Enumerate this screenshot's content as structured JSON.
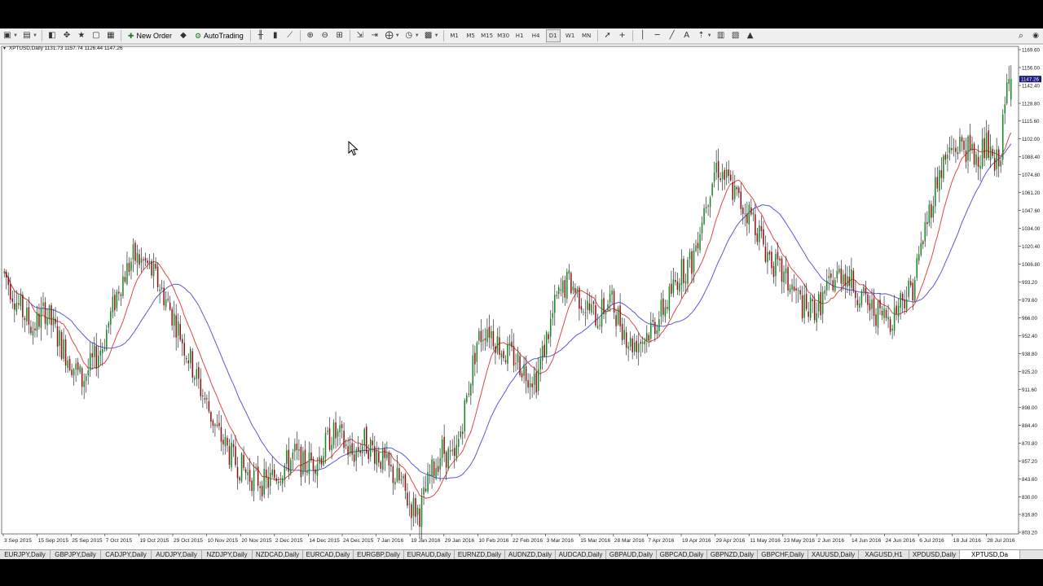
{
  "toolbar": {
    "items": [
      {
        "type": "icon",
        "name": "new-chart-icon",
        "symbol": "▣",
        "dropdown": true
      },
      {
        "type": "icon",
        "name": "profiles-icon",
        "symbol": "▤",
        "dropdown": true
      },
      {
        "type": "sep"
      },
      {
        "type": "icon",
        "name": "market-watch-icon",
        "symbol": "◧"
      },
      {
        "type": "icon",
        "name": "data-window-icon",
        "symbol": "✥"
      },
      {
        "type": "icon",
        "name": "navigator-icon",
        "symbol": "★"
      },
      {
        "type": "icon",
        "name": "terminal-icon",
        "symbol": "▢"
      },
      {
        "type": "icon",
        "name": "strategy-tester-icon",
        "symbol": "▦"
      },
      {
        "type": "sep"
      },
      {
        "type": "text",
        "name": "new-order-button",
        "icon": "✚",
        "label": "New Order"
      },
      {
        "type": "icon",
        "name": "metaeditor-icon",
        "symbol": "◆"
      },
      {
        "type": "text",
        "name": "autotrading-button",
        "icon": "⚙",
        "label": "AutoTrading"
      },
      {
        "type": "sep"
      },
      {
        "type": "icon",
        "name": "bar-chart-icon",
        "symbol": "╫"
      },
      {
        "type": "icon",
        "name": "candlesticks-icon",
        "symbol": "▮"
      },
      {
        "type": "icon",
        "name": "line-chart-icon",
        "symbol": "⟋"
      },
      {
        "type": "sep"
      },
      {
        "type": "icon",
        "name": "zoom-in-icon",
        "symbol": "⊕"
      },
      {
        "type": "icon",
        "name": "zoom-out-icon",
        "symbol": "⊖"
      },
      {
        "type": "icon",
        "name": "tile-windows-icon",
        "symbol": "⊞"
      },
      {
        "type": "sep"
      },
      {
        "type": "icon",
        "name": "auto-scroll-icon",
        "symbol": "⇲"
      },
      {
        "type": "icon",
        "name": "chart-shift-icon",
        "symbol": "⇥"
      },
      {
        "type": "icon",
        "name": "indicators-icon",
        "symbol": "⨁",
        "dropdown": true
      },
      {
        "type": "icon",
        "name": "periods-icon",
        "symbol": "◷",
        "dropdown": true
      },
      {
        "type": "icon",
        "name": "templates-icon",
        "symbol": "▩",
        "dropdown": true
      },
      {
        "type": "sep"
      },
      {
        "type": "tf",
        "name": "timeframe-m1",
        "label": "M1"
      },
      {
        "type": "tf",
        "name": "timeframe-m5",
        "label": "M5"
      },
      {
        "type": "tf",
        "name": "timeframe-m15",
        "label": "M15"
      },
      {
        "type": "tf",
        "name": "timeframe-m30",
        "label": "M30"
      },
      {
        "type": "tf",
        "name": "timeframe-h1",
        "label": "H1"
      },
      {
        "type": "tf",
        "name": "timeframe-h4",
        "label": "H4"
      },
      {
        "type": "tf",
        "name": "timeframe-d1",
        "label": "D1"
      },
      {
        "type": "tf",
        "name": "timeframe-w1",
        "label": "W1"
      },
      {
        "type": "tf",
        "name": "timeframe-mn",
        "label": "MN"
      },
      {
        "type": "sep"
      },
      {
        "type": "icon",
        "name": "cursor-tool-icon",
        "symbol": "➚"
      },
      {
        "type": "icon",
        "name": "crosshair-icon",
        "symbol": "+"
      },
      {
        "type": "sep"
      },
      {
        "type": "icon",
        "name": "vertical-line-icon",
        "symbol": "│"
      },
      {
        "type": "icon",
        "name": "horizontal-line-icon",
        "symbol": "─"
      },
      {
        "type": "icon",
        "name": "trendline-icon",
        "symbol": "╱"
      },
      {
        "type": "icon",
        "name": "text-tool-icon",
        "symbol": "A"
      },
      {
        "type": "icon",
        "name": "arrows-icon",
        "symbol": "⇡",
        "dropdown": true
      },
      {
        "type": "icon",
        "name": "equidistant-channel-icon",
        "symbol": "▥"
      },
      {
        "type": "icon",
        "name": "fibonacci-icon",
        "symbol": "▧"
      },
      {
        "type": "icon",
        "name": "shapes-icon",
        "symbol": "▲"
      }
    ],
    "search_icon": "⌕",
    "account_icon": "◉"
  },
  "chart": {
    "header": "XPTUSD,Daily  1131.73 1157.74 1126.44 1147.26",
    "current_price_label": "1147.26",
    "colors": {
      "bull": "#12881e",
      "bear": "#8c1010",
      "ma_fast": "#e04848",
      "ma_slow": "#5a5ad2",
      "grid_text": "#202020",
      "price_tag": "#1a1a80"
    }
  },
  "chart_data": {
    "type": "candlestick",
    "symbol": "XPTUSD",
    "timeframe": "Daily",
    "ylim": [
      803.2,
      1169.6
    ],
    "y_ticks": [
      "1169.60",
      "1156.00",
      "1142.40",
      "1128.80",
      "1115.60",
      "1102.00",
      "1088.40",
      "1074.80",
      "1061.20",
      "1047.60",
      "1034.00",
      "1020.40",
      "1006.80",
      "993.20",
      "979.60",
      "966.00",
      "952.40",
      "938.80",
      "925.20",
      "911.60",
      "898.00",
      "884.40",
      "870.80",
      "857.20",
      "843.60",
      "830.00",
      "816.80",
      "803.20"
    ],
    "x_labels": [
      "3 Sep 2015",
      "15 Sep 2015",
      "25 Sep 2015",
      "7 Oct 2015",
      "19 Oct 2015",
      "29 Oct 2015",
      "10 Nov 2015",
      "20 Nov 2015",
      "2 Dec 2015",
      "14 Dec 2015",
      "24 Dec 2015",
      "7 Jan 2016",
      "19 Jan 2016",
      "29 Jan 2016",
      "10 Feb 2016",
      "22 Feb 2016",
      "3 Mar 2016",
      "15 Mar 2016",
      "28 Mar 2016",
      "7 Apr 2016",
      "19 Apr 2016",
      "29 Apr 2016",
      "11 May 2016",
      "23 May 2016",
      "2 Jun 2016",
      "14 Jun 2016",
      "24 Jun 2016",
      "6 Jul 2016",
      "18 Jul 2016",
      "28 Jul 2016"
    ],
    "last_bar": {
      "open": 1131.73,
      "high": 1157.74,
      "low": 1126.44,
      "close": 1147.26
    },
    "path_anchors": [
      [
        0,
        1000
      ],
      [
        7,
        975
      ],
      [
        14,
        958
      ],
      [
        20,
        972
      ],
      [
        28,
        945
      ],
      [
        38,
        918
      ],
      [
        48,
        945
      ],
      [
        56,
        990
      ],
      [
        63,
        1012
      ],
      [
        70,
        1006
      ],
      [
        76,
        990
      ],
      [
        84,
        962
      ],
      [
        94,
        920
      ],
      [
        104,
        880
      ],
      [
        112,
        858
      ],
      [
        120,
        846
      ],
      [
        128,
        840
      ],
      [
        136,
        852
      ],
      [
        142,
        862
      ],
      [
        146,
        854
      ],
      [
        154,
        860
      ],
      [
        160,
        878
      ],
      [
        164,
        875
      ],
      [
        170,
        862
      ],
      [
        176,
        872
      ],
      [
        182,
        864
      ],
      [
        188,
        850
      ],
      [
        194,
        840
      ],
      [
        198,
        825
      ],
      [
        203,
        818
      ],
      [
        208,
        845
      ],
      [
        214,
        866
      ],
      [
        220,
        856
      ],
      [
        226,
        905
      ],
      [
        231,
        948
      ],
      [
        236,
        960
      ],
      [
        244,
        940
      ],
      [
        250,
        935
      ],
      [
        255,
        925
      ],
      [
        260,
        920
      ],
      [
        264,
        944
      ],
      [
        270,
        980
      ],
      [
        276,
        994
      ],
      [
        284,
        975
      ],
      [
        290,
        966
      ],
      [
        296,
        980
      ],
      [
        302,
        960
      ],
      [
        306,
        946
      ],
      [
        312,
        950
      ],
      [
        318,
        962
      ],
      [
        324,
        978
      ],
      [
        330,
        1000
      ],
      [
        336,
        1008
      ],
      [
        342,
        1050
      ],
      [
        348,
        1082
      ],
      [
        354,
        1068
      ],
      [
        360,
        1052
      ],
      [
        366,
        1042
      ],
      [
        372,
        1018
      ],
      [
        378,
        1002
      ],
      [
        386,
        986
      ],
      [
        392,
        970
      ],
      [
        398,
        975
      ],
      [
        404,
        992
      ],
      [
        410,
        1002
      ],
      [
        416,
        988
      ],
      [
        422,
        975
      ],
      [
        428,
        968
      ],
      [
        434,
        966
      ],
      [
        438,
        980
      ],
      [
        444,
        990
      ],
      [
        450,
        1034
      ],
      [
        456,
        1072
      ],
      [
        462,
        1092
      ],
      [
        468,
        1098
      ],
      [
        474,
        1088
      ],
      [
        480,
        1096
      ],
      [
        484,
        1078
      ],
      [
        487,
        1095
      ],
      [
        490,
        1140
      ],
      [
        492,
        1150
      ]
    ],
    "ma_fast_period": 14,
    "ma_slow_period": 34
  },
  "symbol_tabs": [
    {
      "label": "EURJPY,Daily"
    },
    {
      "label": "GBPJPY,Daily"
    },
    {
      "label": "CADJPY,Daily"
    },
    {
      "label": "AUDJPY,Daily"
    },
    {
      "label": "NZDJPY,Daily"
    },
    {
      "label": "NZDCAD,Daily"
    },
    {
      "label": "EURCAD,Daily"
    },
    {
      "label": "EURGBP,Daily"
    },
    {
      "label": "EURAUD,Daily"
    },
    {
      "label": "EURNZD,Daily"
    },
    {
      "label": "AUDNZD,Daily"
    },
    {
      "label": "AUDCAD,Daily"
    },
    {
      "label": "GBPAUD,Daily"
    },
    {
      "label": "GBPCAD,Daily"
    },
    {
      "label": "GBPNZD,Daily"
    },
    {
      "label": "GBPCHF,Daily"
    },
    {
      "label": "XAUUSD,Daily"
    },
    {
      "label": "XAGUSD,H1"
    },
    {
      "label": "XPDUSD,Daily"
    },
    {
      "label": "XPTUSD,Da"
    }
  ],
  "active_tab_index": 19
}
